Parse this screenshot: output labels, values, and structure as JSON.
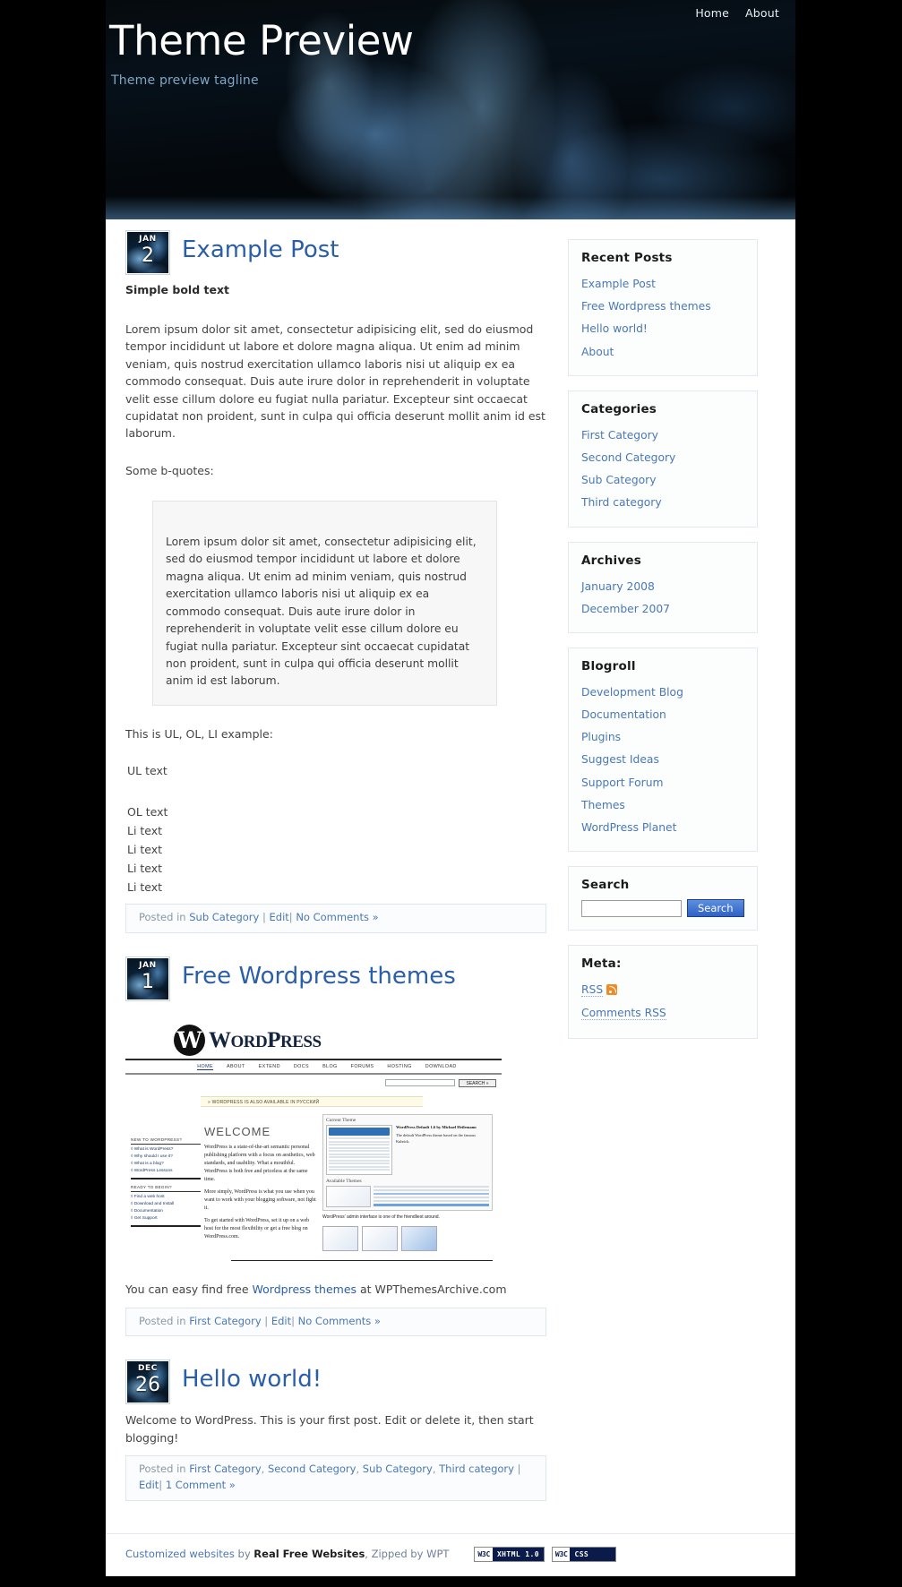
{
  "site": {
    "title": "Theme Preview",
    "tagline": "Theme preview tagline",
    "nav": [
      {
        "label": "Home"
      },
      {
        "label": "About"
      }
    ]
  },
  "posts": [
    {
      "date": {
        "month": "JAN",
        "day": "2"
      },
      "title": "Example Post",
      "subtitle": "Simple bold text",
      "body1": "Lorem ipsum dolor sit amet, consectetur adipisicing elit, sed do eiusmod tempor incididunt ut labore et dolore magna aliqua. Ut enim ad minim veniam, quis nostrud exercitation ullamco laboris nisi ut aliquip ex ea commodo consequat. Duis aute irure dolor in reprehenderit in voluptate velit esse cillum dolore eu fugiat nulla pariatur. Excepteur sint occaecat cupidatat non proident, sunt in culpa qui officia deserunt mollit anim id est laborum.",
      "quote_intro": "Some b-quotes:",
      "quote": "Lorem ipsum dolor sit amet, consectetur adipisicing elit, sed do eiusmod tempor incididunt ut labore et dolore magna aliqua. Ut enim ad minim veniam, quis nostrud exercitation ullamco laboris nisi ut aliquip ex ea commodo consequat. Duis aute irure dolor in reprehenderit in voluptate velit esse cillum dolore eu fugiat nulla pariatur. Excepteur sint occaecat cupidatat non proident, sunt in culpa qui officia deserunt mollit anim id est laborum.",
      "list_intro": "This is UL, OL, LI example:",
      "ul_text": "UL text",
      "ol_text": "OL text",
      "li_items": [
        "Li text",
        "Li text",
        "Li text",
        "Li text"
      ],
      "meta": {
        "posted_in_label": "Posted in",
        "categories": [
          "Sub Category"
        ],
        "separator": " | ",
        "edit_label": "Edit",
        "comments_label": "No Comments »"
      }
    },
    {
      "date": {
        "month": "JAN",
        "day": "1"
      },
      "title": "Free Wordpress themes",
      "caption_pre": "You can easy find free ",
      "caption_link": "Wordpress themes",
      "caption_post": " at WPThemesArchive.com",
      "meta": {
        "posted_in_label": "Posted in",
        "categories": [
          "First Category"
        ],
        "separator": " | ",
        "edit_label": "Edit",
        "comments_label": "No Comments »"
      }
    },
    {
      "date": {
        "month": "DEC",
        "day": "26"
      },
      "title": "Hello world!",
      "body1": "Welcome to WordPress. This is your first post. Edit or delete it, then start blogging!",
      "meta": {
        "posted_in_label": "Posted in",
        "categories": [
          "First Category",
          "Second Category",
          "Sub Category",
          "Third category"
        ],
        "separator": " | ",
        "edit_label": "Edit",
        "comments_label": "1 Comment »"
      }
    }
  ],
  "wp_screenshot": {
    "logo_w": "W",
    "logo_word_a": "W",
    "logo_word_b": "ORD",
    "logo_word_c": "P",
    "logo_word_d": "RESS",
    "nav": [
      "HOME",
      "ABOUT",
      "EXTEND",
      "DOCS",
      "BLOG",
      "FORUMS",
      "HOSTING",
      "DOWNLOAD"
    ],
    "search_button": "SEARCH »",
    "notice": "» WORDPRESS IS ALSO AVAILABLE IN РУССКИЙ",
    "welcome_heading": "WELCOME",
    "welcome_p1": "WordPress is a state-of-the-art semantic personal publishing platform with a focus on aesthetics, web standards, and usability. What a mouthful. WordPress is both free and priceless at the same time.",
    "welcome_p2": "More simply, WordPress is what you use when you want to work with your blogging software, not fight it.",
    "welcome_p3": "To get started with WordPress, set it up on a web host for the most flexibility or get a free blog on WordPress.com.",
    "left_head_1": "NEW TO WORDPRESS?",
    "left_links_1": [
      "◊ What is WordPress?",
      "◊ Why should I use it?",
      "◊ What is a blog?",
      "◊ WordPress Lessons"
    ],
    "left_head_2": "READY TO BEGIN?",
    "left_links_2": [
      "◊ Find a web host",
      "◊ Download and Install",
      "◊ Documentation",
      "◊ Get Support"
    ],
    "panel_title": "Current Theme",
    "panel_theme_name": "WordPress Default 1.6 by Michael Heilemann",
    "panel_theme_desc": "The default WordPress theme based on the famous Kubrick.",
    "panel_available": "Available Themes",
    "admin_caption": "WordPress' admin interface is one of the friendliest around."
  },
  "sidebar": {
    "widgets": [
      {
        "title": "Recent Posts",
        "items": [
          "Example Post",
          "Free Wordpress themes",
          "Hello world!",
          "About"
        ]
      },
      {
        "title": "Categories",
        "items": [
          "First Category",
          "Second Category",
          "Sub Category",
          "Third category"
        ]
      },
      {
        "title": "Archives",
        "items": [
          "January 2008",
          "December 2007"
        ]
      },
      {
        "title": "Blogroll",
        "items": [
          "Development Blog",
          "Documentation",
          "Plugins",
          "Suggest Ideas",
          "Support Forum",
          "Themes",
          "WordPress Planet"
        ]
      }
    ],
    "search": {
      "title": "Search",
      "value": "",
      "placeholder": "",
      "button": "Search"
    },
    "meta": {
      "title": "Meta:",
      "rss_label": "RSS",
      "comments_rss_label": "Comments RSS"
    }
  },
  "footer": {
    "credit_link": "Customized websites",
    "credit_mid": " by ",
    "credit_bold": "Real Free Websites",
    "credit_end": ", Zipped by WPT",
    "badges": [
      {
        "w3c": "W3C",
        "label": "XHTML 1.0"
      },
      {
        "w3c": "W3C",
        "label": "CSS"
      }
    ]
  },
  "colors": {
    "link": "#4a78b5",
    "title_link": "#2b5ea8",
    "tagline": "#7fa6c4",
    "accent_blue": "#2f62c4",
    "rss_orange": "#f08a24"
  }
}
